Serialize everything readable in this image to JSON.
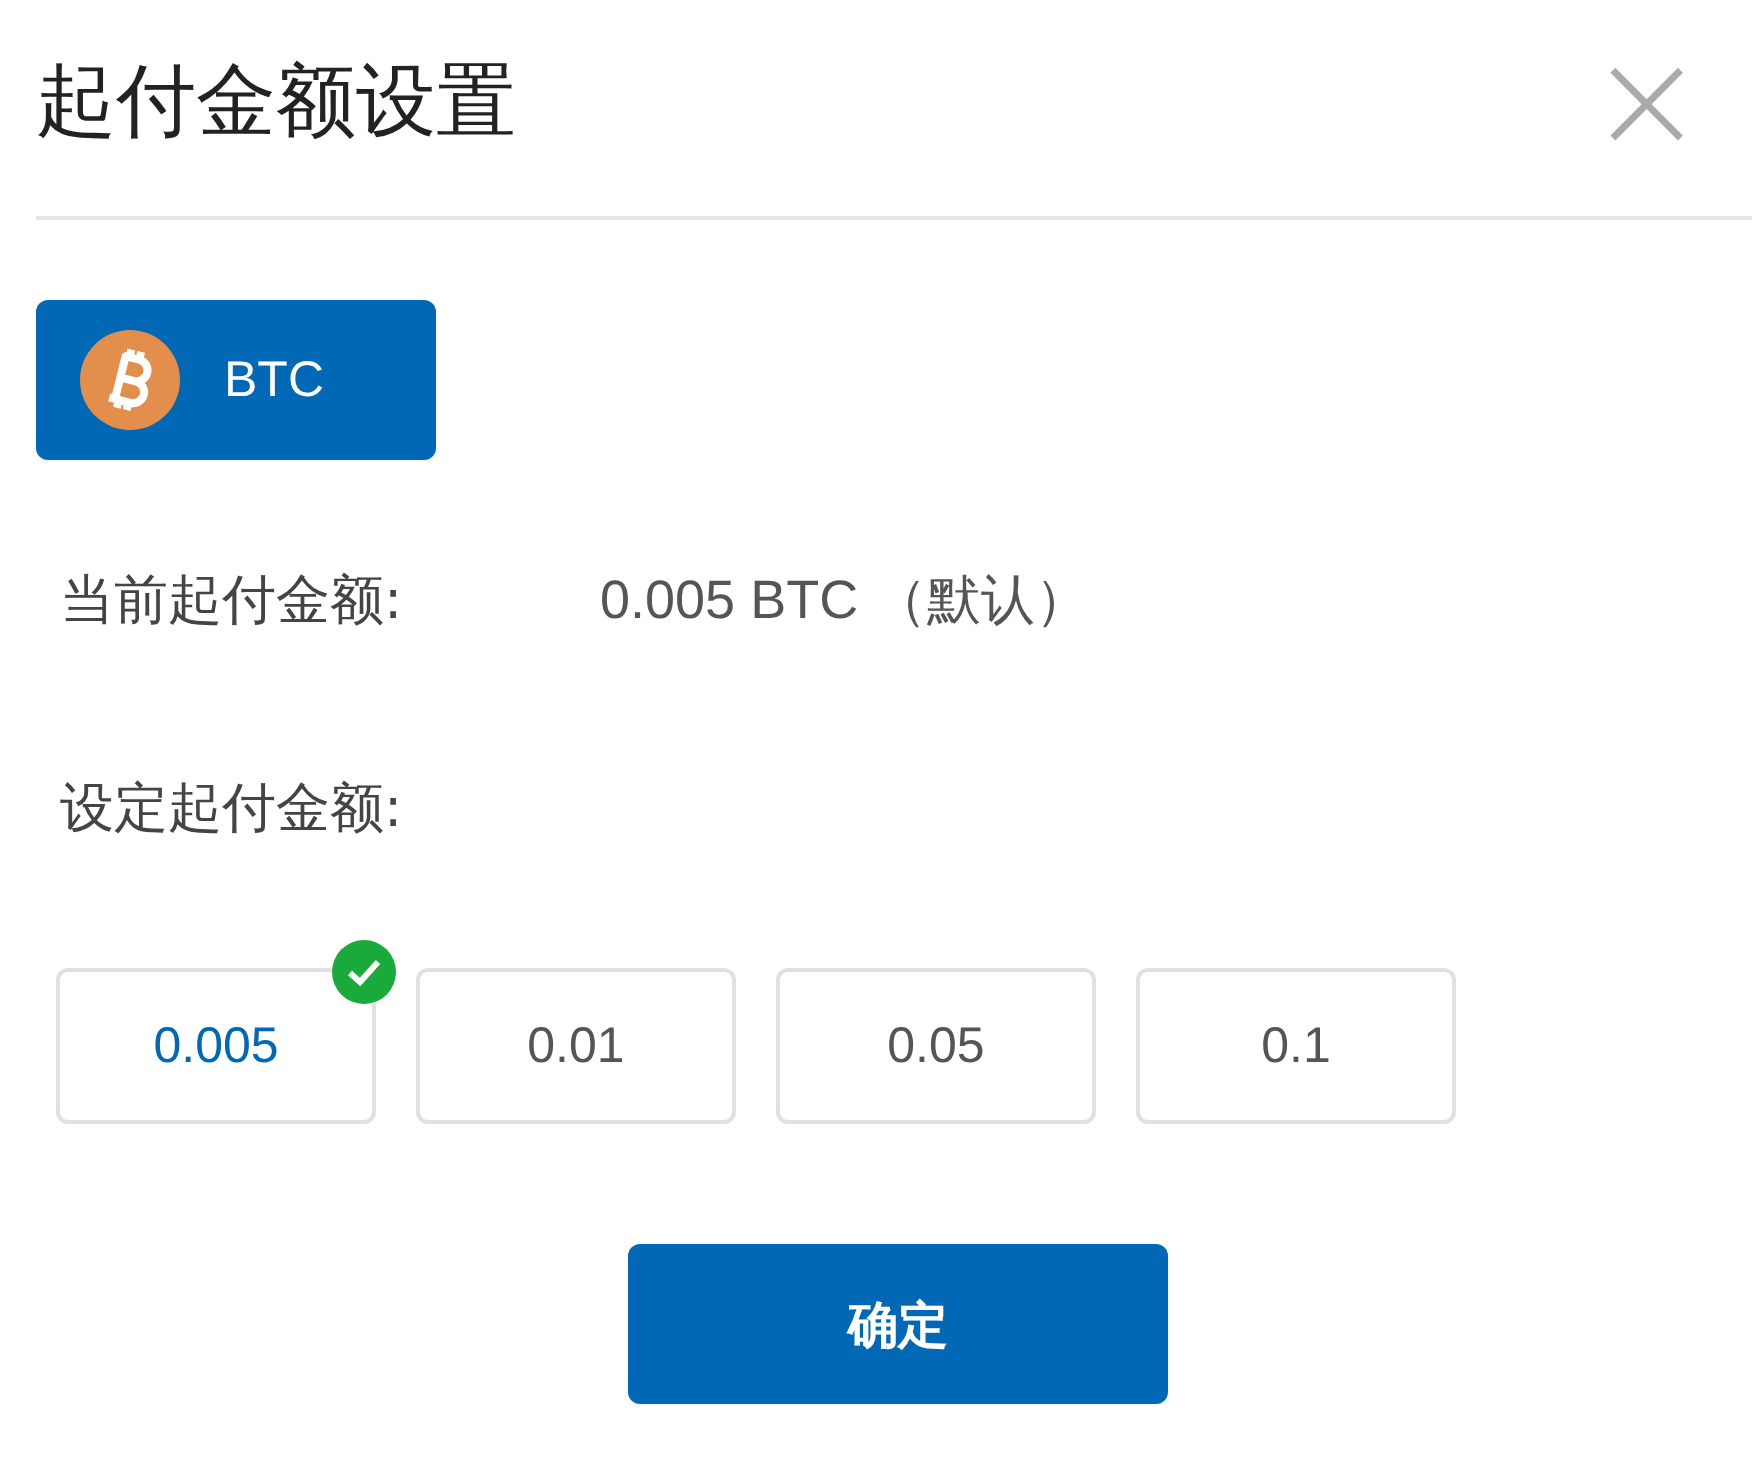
{
  "dialog": {
    "title": "起付金额设置",
    "close": "×"
  },
  "coin": {
    "label": "BTC"
  },
  "current": {
    "label": "当前起付金额:",
    "value": "0.005 BTC （默认）"
  },
  "set_label": "设定起付金额:",
  "options": [
    {
      "label": "0.005",
      "selected": true
    },
    {
      "label": "0.01",
      "selected": false
    },
    {
      "label": "0.05",
      "selected": false
    },
    {
      "label": "0.1",
      "selected": false
    }
  ],
  "confirm": "确定"
}
